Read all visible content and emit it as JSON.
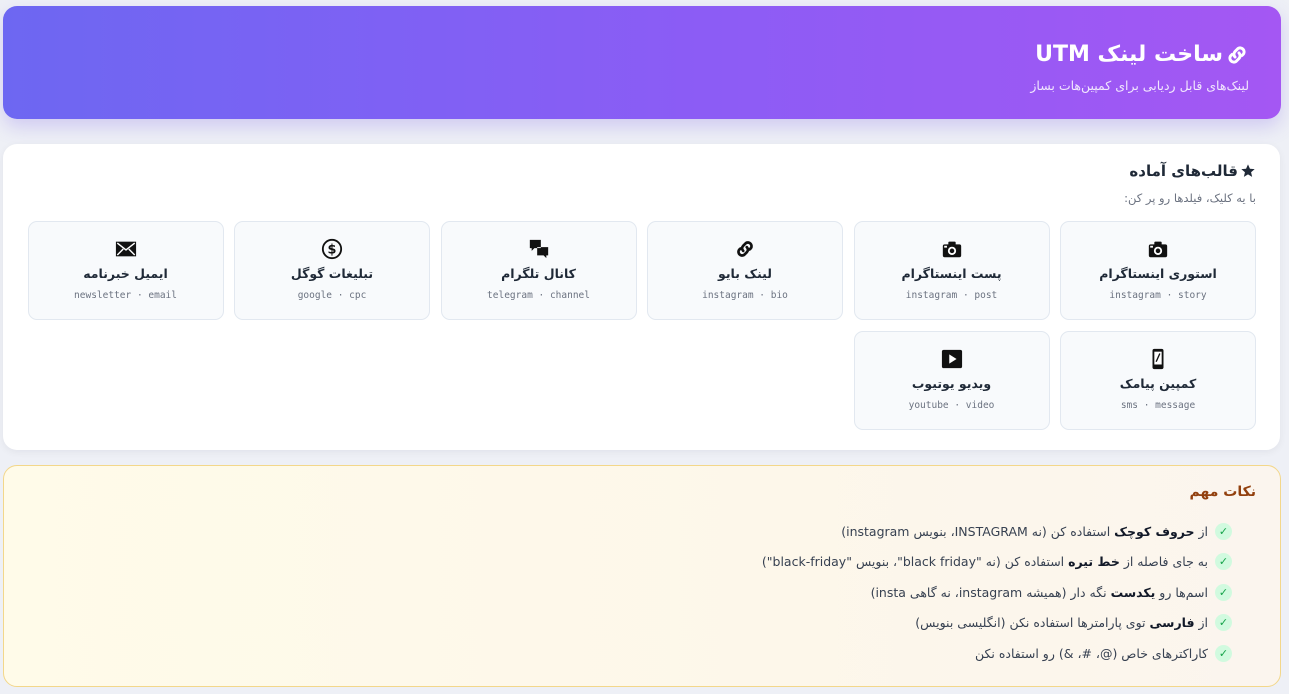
{
  "header": {
    "title": "ساخت لینک UTM",
    "subtitle": "لینک‌های قابل ردیابی برای کمپین‌هات بساز",
    "icon": "link-icon",
    "gradient": [
      "#6d67f2",
      "#a457f3"
    ]
  },
  "templates": {
    "title": "قالب‌های آماده",
    "hint": "با یه کلیک، فیلدها رو پر کن:",
    "items": [
      {
        "name": "استوری اینستاگرام",
        "tags": "instagram · story",
        "icon": "camera-icon"
      },
      {
        "name": "پست اینستاگرام",
        "tags": "instagram · post",
        "icon": "camera-icon"
      },
      {
        "name": "لینک بایو",
        "tags": "instagram · bio",
        "icon": "link-icon"
      },
      {
        "name": "کانال تلگرام",
        "tags": "telegram · channel",
        "icon": "speech-bubbles-icon"
      },
      {
        "name": "تبلیغات گوگل",
        "tags": "google · cpc",
        "icon": "dollar-icon"
      },
      {
        "name": "ایمیل خبرنامه",
        "tags": "newsletter · email",
        "icon": "envelope-icon"
      },
      {
        "name": "کمپین پیامک",
        "tags": "sms · message",
        "icon": "mobile-phone-icon"
      },
      {
        "name": "ویدیو یوتیوب",
        "tags": "youtube · video",
        "icon": "play-button-icon"
      }
    ]
  },
  "tips": {
    "title": "نکات مهم",
    "accent": "#92400e",
    "items": [
      {
        "pre": "از ",
        "bold": "حروف کوچک",
        "post": " استفاده کن (نه INSTAGRAM، بنویس instagram)"
      },
      {
        "pre": "به جای فاصله از ",
        "bold": "خط تیره",
        "post": " استفاده کن (نه \"black friday\"، بنویس \"black-friday\")"
      },
      {
        "pre": "اسم‌ها رو ",
        "bold": "یکدست",
        "post": " نگه دار (همیشه instagram، نه گاهی insta)"
      },
      {
        "pre": "از ",
        "bold": "فارسی",
        "post": " توی پارامترها استفاده نکن (انگلیسی بنویس)"
      },
      {
        "pre": "کاراکترهای خاص (@، #، &) رو استفاده نکن",
        "bold": "",
        "post": ""
      }
    ]
  }
}
